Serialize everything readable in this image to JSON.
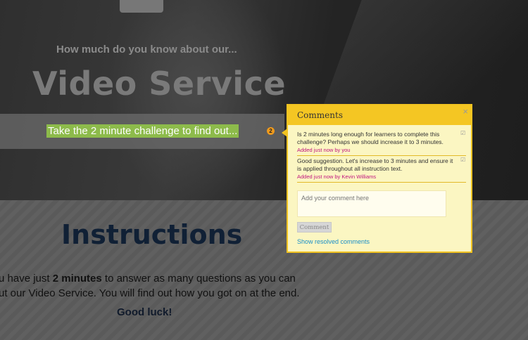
{
  "hero": {
    "subtitle": "How much do you know about our...",
    "title": "Video Service",
    "challenge": "Take the 2 minute challenge to find out...",
    "comment_count": "2"
  },
  "instructions": {
    "title": "Instructions",
    "line1_prefix": "u have just ",
    "line1_bold": "2 minutes",
    "line1_suffix": " to answer as many questions as you can",
    "line2": "ut our Video Service. You will find out how you got on at the end.",
    "good_luck": "Good luck!"
  },
  "comments_popup": {
    "title": "Comments",
    "close_glyph": "×",
    "comments": [
      {
        "text": "Is 2 minutes long enough for learners to complete this challenge? Perhaps we should increase it to 3 minutes.",
        "meta": "Added just now by you"
      },
      {
        "text": "Good suggestion. Let's increase to 3 minutes and ensure it is applied throughout all instruction text.",
        "meta_prefix": "Added just now",
        "meta_author": " by Kevin Williams"
      }
    ],
    "input_placeholder": "Add your comment here",
    "button_label": "Comment",
    "show_resolved": "Show resolved comments"
  },
  "colors": {
    "popup_border": "#f2c320",
    "popup_bg": "#fbf6c2",
    "highlight": "#8dbb4b",
    "link": "#1a8fc7",
    "meta": "#c0147f"
  }
}
